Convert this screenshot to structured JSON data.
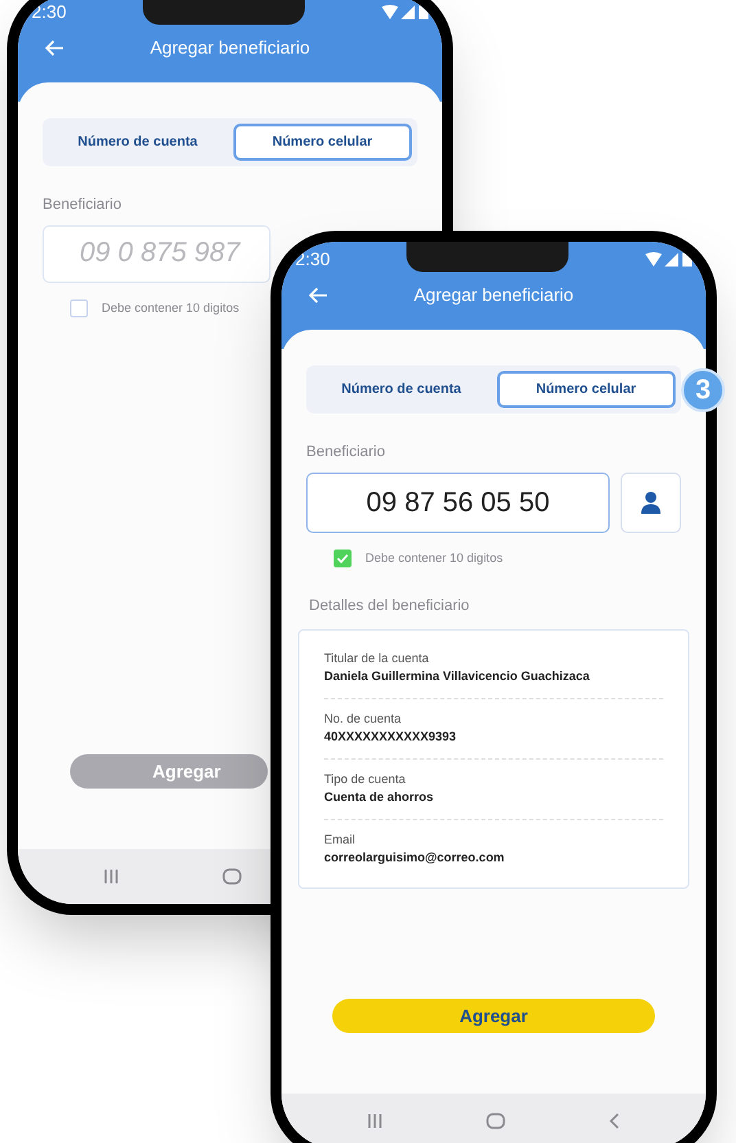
{
  "phones": [
    {
      "status_time": "2:30",
      "title": "Agregar beneficiario",
      "tabs": [
        {
          "label": "Número de cuenta",
          "selected": false
        },
        {
          "label": "Número celular",
          "selected": true
        }
      ],
      "field_label": "Beneficiario",
      "field": {
        "placeholder": "09 0 875 987"
      },
      "validation": {
        "label": "Debe contener 10 digitos",
        "checked": false
      },
      "submit": {
        "label": "Agregar",
        "disabled": true
      }
    },
    {
      "status_time": "2:30",
      "title": "Agregar beneficiario",
      "tabs": [
        {
          "label": "Número de cuenta",
          "selected": false
        },
        {
          "label": "Número celular",
          "selected": true
        }
      ],
      "field_label": "Beneficiario",
      "field": {
        "value": "09 87 56 05 50"
      },
      "validation": {
        "label": "Debe contener 10 digitos",
        "checked": true
      },
      "details": {
        "title": "Detalles del beneficiario",
        "rows": [
          {
            "label": "Titular de la cuenta",
            "value": "Daniela Guillermina Villavicencio Guachizaca"
          },
          {
            "label": "No. de cuenta",
            "value": "40XXXXXXXXXXX9393"
          },
          {
            "label": "Tipo de cuenta",
            "value": "Cuenta de ahorros"
          },
          {
            "label": "Email",
            "value": "correolarguisimo@correo.com"
          }
        ]
      },
      "submit": {
        "label": "Agregar",
        "disabled": false
      }
    }
  ],
  "step_badge": "3"
}
